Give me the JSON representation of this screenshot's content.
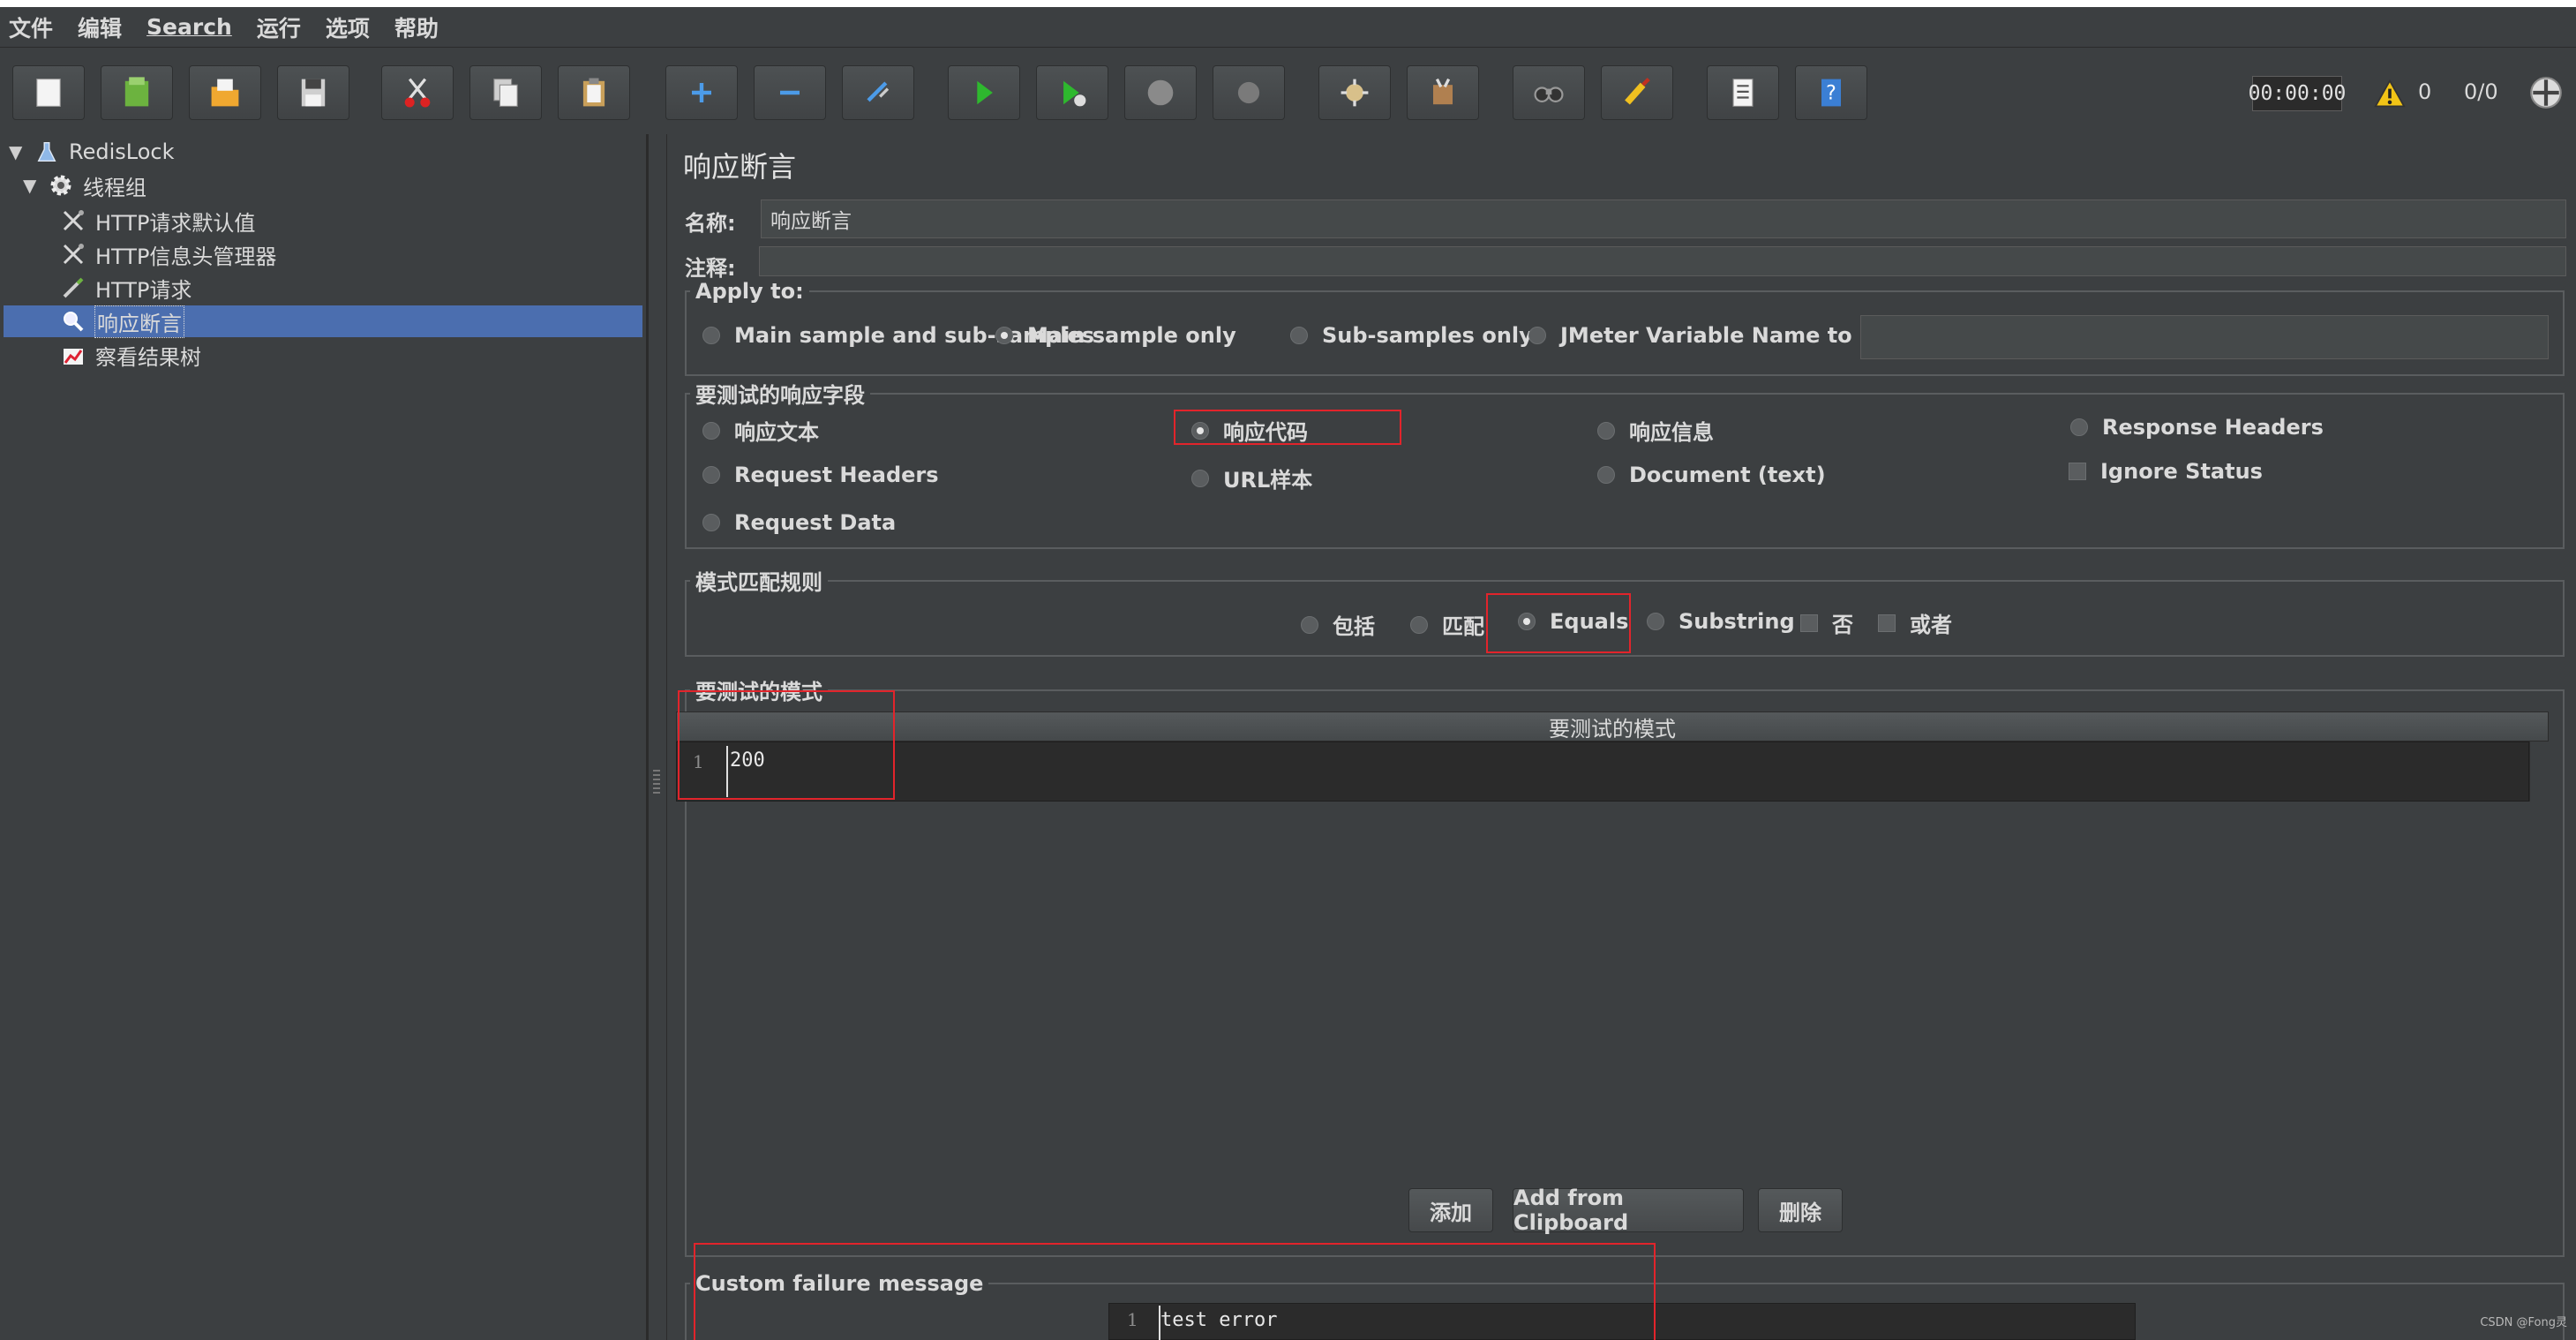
{
  "menu": [
    "文件",
    "编辑",
    "Search",
    "运行",
    "选项",
    "帮助"
  ],
  "toolbar": {
    "timer": "00:00:00",
    "warning_count": "0",
    "threads": "0/0",
    "icons": [
      "new-icon",
      "templates-icon",
      "open-icon",
      "save-icon",
      "cut-icon",
      "copy-icon",
      "paste-icon",
      "expand-icon",
      "collapse-icon",
      "toggle-icon",
      "start-icon",
      "start-no-pause-icon",
      "stop-icon",
      "shutdown-icon",
      "clear-icon",
      "clear-all-icon",
      "search-icon",
      "reset-search-icon",
      "function-helper-icon",
      "help-icon",
      "warning-icon",
      "remote-icon"
    ]
  },
  "tree": {
    "items": [
      {
        "label": "RedisLock",
        "icon": "test-plan-icon"
      },
      {
        "label": "线程组",
        "icon": "thread-group-icon"
      },
      {
        "label": "HTTP请求默认值",
        "icon": "config-icon"
      },
      {
        "label": "HTTP信息头管理器",
        "icon": "config-icon"
      },
      {
        "label": "HTTP请求",
        "icon": "sampler-icon"
      },
      {
        "label": "响应断言",
        "icon": "assertion-icon"
      },
      {
        "label": "察看结果树",
        "icon": "listener-icon"
      }
    ]
  },
  "panel": {
    "title": "响应断言",
    "name_label": "名称:",
    "name_value": "响应断言",
    "comment_label": "注释:",
    "comment_value": ""
  },
  "apply_to": {
    "legend": "Apply to:",
    "options": [
      "Main sample and sub-samples",
      "Main sample only",
      "Sub-samples only",
      "JMeter Variable Name to use"
    ],
    "selected": "Main sample only",
    "variable_value": ""
  },
  "field_to_test": {
    "legend": "要测试的响应字段",
    "options": [
      "响应文本",
      "响应代码",
      "响应信息",
      "Response Headers",
      "Request Headers",
      "URL样本",
      "Document (text)",
      "Request Data"
    ],
    "ignore_status": "Ignore Status",
    "selected": "响应代码"
  },
  "pattern_rules": {
    "legend": "模式匹配规则",
    "options": [
      "包括",
      "匹配",
      "Equals",
      "Substring"
    ],
    "checks": [
      "否",
      "或者"
    ],
    "selected": "Equals"
  },
  "patterns": {
    "legend": "要测试的模式",
    "column_header": "要测试的模式",
    "line_no": "1",
    "value": "200"
  },
  "buttons": {
    "add": "添加",
    "add_clipboard": "Add from Clipboard",
    "delete": "删除"
  },
  "failure": {
    "legend": "Custom failure message",
    "line_no": "1",
    "value": "test error"
  },
  "watermark": "CSDN @Fong灵"
}
